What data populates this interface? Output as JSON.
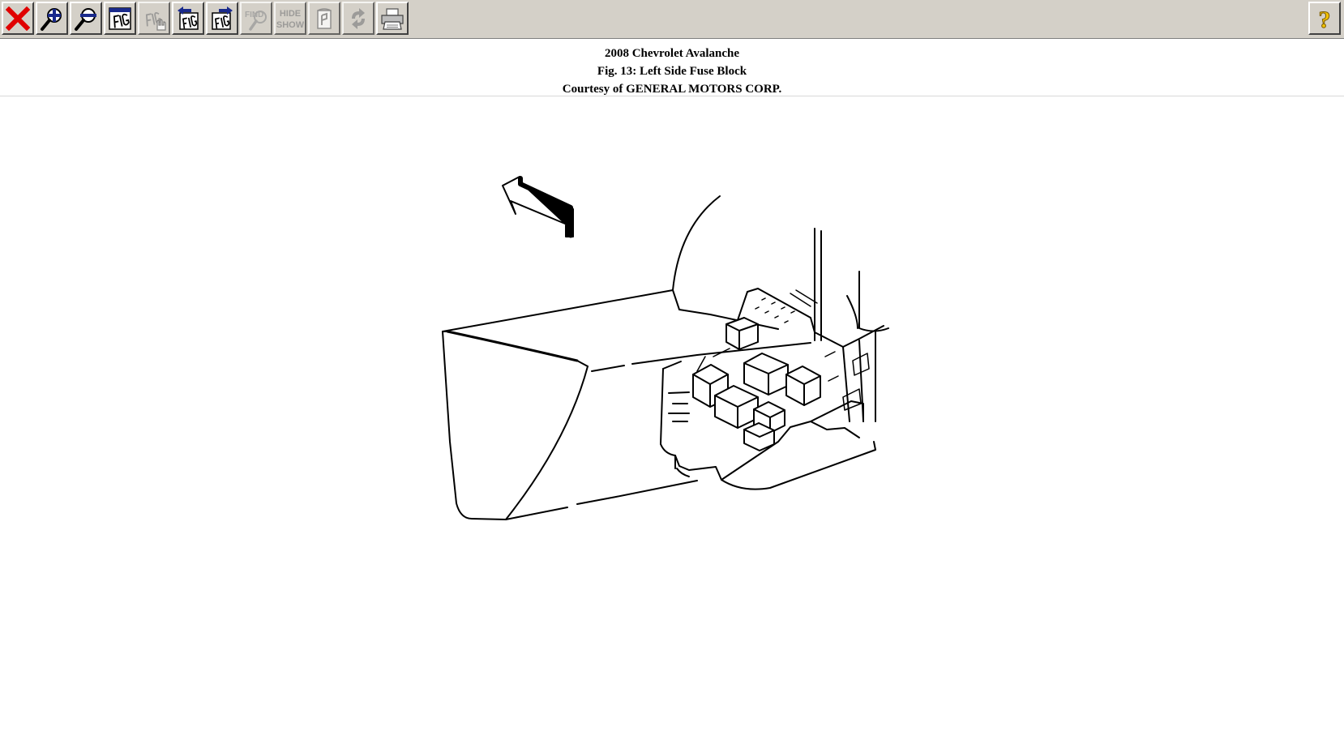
{
  "toolbar": {
    "buttons": [
      {
        "id": "close",
        "icon": "close-icon"
      },
      {
        "id": "zoom-in",
        "icon": "zoom-in-icon"
      },
      {
        "id": "zoom-out",
        "icon": "zoom-out-icon"
      },
      {
        "id": "figure",
        "icon": "figure-icon",
        "label": "FIG"
      },
      {
        "id": "figure-select",
        "icon": "figure-hand-icon",
        "label": "FIG"
      },
      {
        "id": "previous-figure",
        "icon": "previous-figure-icon",
        "label": "FIG"
      },
      {
        "id": "next-figure",
        "icon": "next-figure-icon",
        "label": "FIG"
      },
      {
        "id": "find",
        "icon": "find-icon",
        "label": "FIND"
      },
      {
        "id": "hide-show",
        "icon": "hide-show-icon",
        "label_top": "HIDE",
        "label_bottom": "SHOW"
      },
      {
        "id": "notes",
        "icon": "notes-icon"
      },
      {
        "id": "refresh",
        "icon": "refresh-icon"
      },
      {
        "id": "print",
        "icon": "printer-icon"
      }
    ],
    "help": {
      "id": "help",
      "icon": "help-icon",
      "label": "?"
    }
  },
  "header": {
    "vehicle": "2008 Chevrolet Avalanche",
    "figure_title": "Fig. 13: Left Side Fuse Block",
    "courtesy": "Courtesy of GENERAL MOTORS CORP."
  },
  "figure": {
    "subject": "left-side-fuse-block-illustration"
  },
  "colors": {
    "toolbar_bg": "#d4d0c8",
    "close_red": "#e00000",
    "icon_blue": "#1a2a8c",
    "help_yellow": "#f2c200"
  }
}
